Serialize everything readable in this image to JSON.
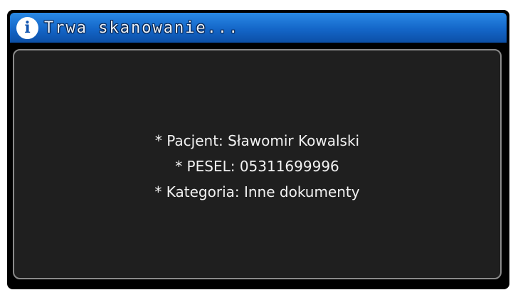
{
  "dialog": {
    "icon": "info-icon",
    "icon_glyph": "i",
    "title": "Trwa skanowanie...",
    "accent_color": "#1466c8",
    "panel_background": "#1f1f1f"
  },
  "details": {
    "lines": [
      "* Pacjent: Sławomir Kowalski",
      "* PESEL: 05311699996",
      "* Kategoria: Inne dokumenty"
    ]
  }
}
